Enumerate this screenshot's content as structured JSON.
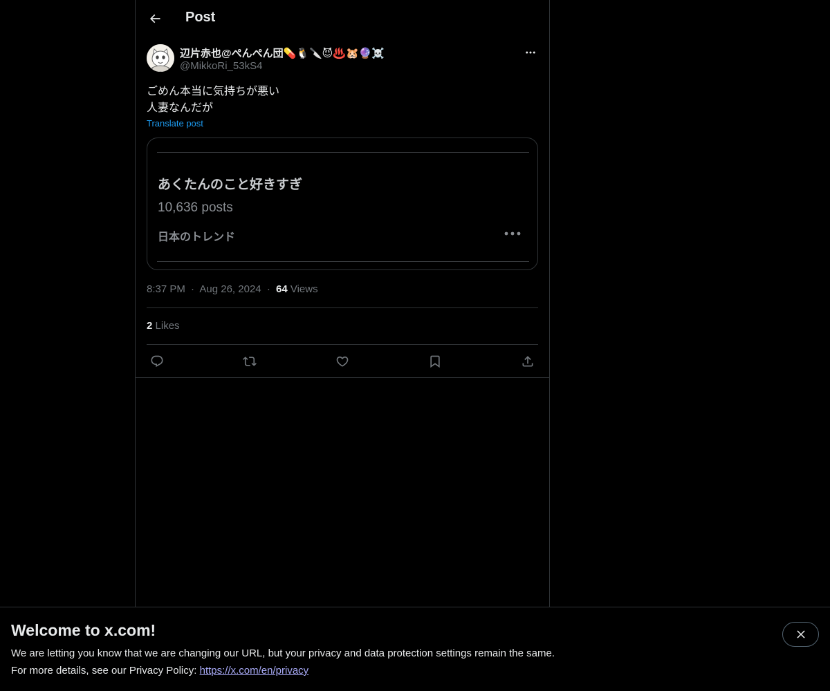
{
  "header": {
    "title": "Post",
    "back_icon": "arrow-left-icon"
  },
  "post": {
    "author": {
      "display_name": "辺片赤也@ぺんぺん団💊🐧🔪😈♨️🐹🔮☠️",
      "handle": "@MikkoRi_53kS4",
      "avatar_icon": "cat-avatar"
    },
    "text_lines": [
      "ごめん本当に気持ちが悪い",
      "人妻なんだが"
    ],
    "translate_label": "Translate post",
    "media": {
      "trend_title": "あくたんのこと好きすぎ",
      "trend_count": "10,636 posts",
      "trend_region": "日本のトレンド"
    },
    "time": "8:37 PM",
    "date": "Aug 26, 2024",
    "separator": "·",
    "views_count": "64",
    "views_label": "Views",
    "likes_count": "2",
    "likes_label": "Likes",
    "actions": [
      "reply-icon",
      "repost-icon",
      "like-icon",
      "bookmark-icon",
      "share-icon"
    ]
  },
  "banner": {
    "title": "Welcome to x.com!",
    "line1": "We are letting you know that we are changing our URL, but your privacy and data protection settings remain the same.",
    "line2_prefix": "For more details, see our Privacy Policy:",
    "link_text": "https://x.com/en/privacy",
    "close_icon": "close-icon"
  },
  "colors": {
    "background": "#000000",
    "text_primary": "#e7e9ea",
    "text_secondary": "#71767b",
    "accent": "#1d9bf0",
    "border": "#2f3336"
  }
}
